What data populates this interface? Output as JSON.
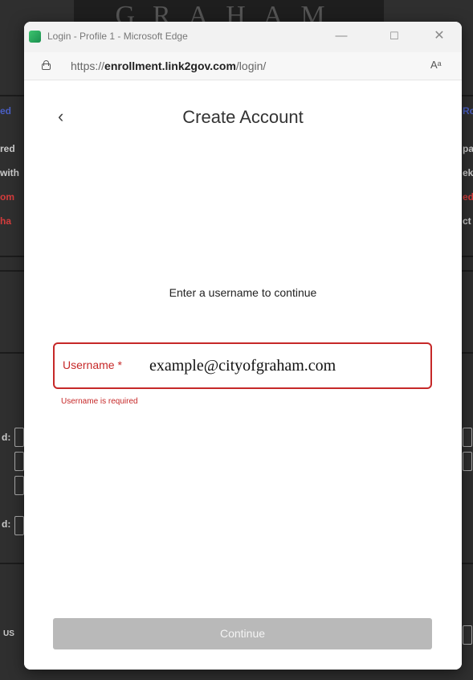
{
  "background": {
    "header_text": "GRAHAM",
    "fragments": [
      "ed",
      "red",
      "with",
      "om",
      "ha",
      "d:",
      "d:",
      "Ro",
      "pa",
      "ek",
      "ed",
      "ct",
      "US"
    ]
  },
  "browser": {
    "title": "Login - Profile 1 - Microsoft Edge",
    "controls": {
      "minimize": "—",
      "maximize": "☐",
      "close": "✕"
    },
    "url": {
      "prefix": "https://",
      "domain": "enrollment.link2gov.com",
      "path": "/login/"
    },
    "read_aloud_icon": "Aᵃ"
  },
  "page": {
    "back_label": "‹",
    "title": "Create Account",
    "prompt": "Enter a username to continue",
    "username": {
      "label": "Username *",
      "value": "example@cityofgraham.com",
      "error": "Username is required"
    },
    "continue_label": "Continue"
  },
  "colors": {
    "error": "#c62828",
    "disabled_button": "#b9b9b9"
  }
}
